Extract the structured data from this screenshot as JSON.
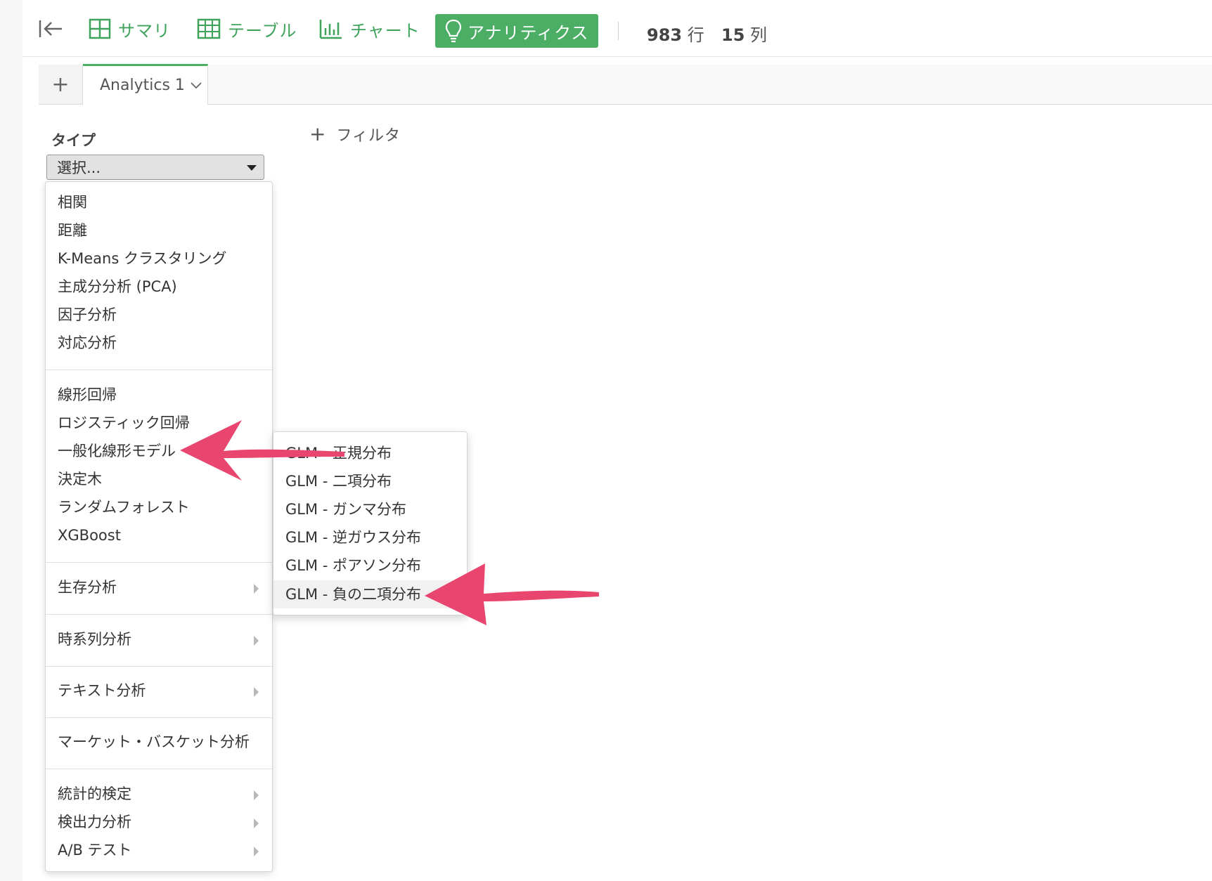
{
  "toolbar": {
    "back_icon": "collapse-left-icon",
    "summary_label": "サマリ",
    "table_label": "テーブル",
    "chart_label": "チャート",
    "analytics_label": "アナリティクス",
    "rows_value": "983",
    "rows_unit": "行",
    "cols_value": "15",
    "cols_unit": "列"
  },
  "tabs": {
    "add_label": "+",
    "active_label": "Analytics 1"
  },
  "panel": {
    "type_label": "タイプ",
    "select_value": "選択...",
    "filter_label": "フィルタ"
  },
  "menu": {
    "group1": [
      "相関",
      "距離",
      "K-Means クラスタリング",
      "主成分分析 (PCA)",
      "因子分析",
      "対応分析"
    ],
    "group2": [
      "線形回帰",
      "ロジスティック回帰",
      "一般化線形モデル",
      "決定木",
      "ランダムフォレスト",
      "XGBoost"
    ],
    "survival": "生存分析",
    "timeseries": "時系列分析",
    "text": "テキスト分析",
    "basket": "マーケット・バスケット分析",
    "stats": "統計的検定",
    "power": "検出力分析",
    "ab": "A/B テスト"
  },
  "submenu": {
    "items": [
      "GLM - 正規分布",
      "GLM - 二項分布",
      "GLM - ガンマ分布",
      "GLM - 逆ガウス分布",
      "GLM - ポアソン分布",
      "GLM - 負の二項分布"
    ]
  },
  "colors": {
    "accent": "#4cae65",
    "arrow": "#e8456f"
  }
}
